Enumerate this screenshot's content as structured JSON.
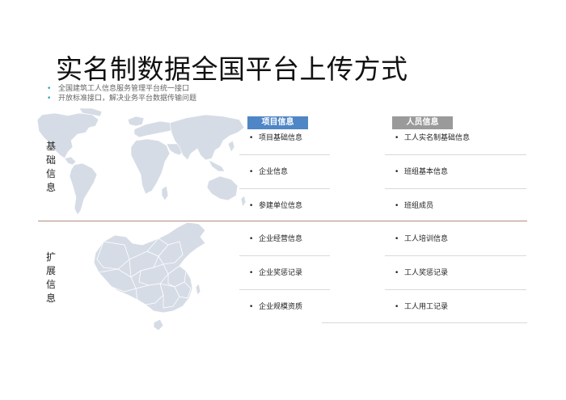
{
  "title": "实名制数据全国平台上传方式",
  "bullets": [
    "全国建筑工人信息服务管理平台统一接口",
    "开放标准接口，解决业务平台数据传输问题"
  ],
  "side_labels": {
    "basic": "基础信息",
    "extended": "扩展信息"
  },
  "columns": {
    "project": {
      "header": "项目信息",
      "items": [
        "项目基础信息",
        "企业信息",
        "参建单位信息",
        "企业经营信息",
        "企业奖惩记录",
        "企业规模资质"
      ]
    },
    "people": {
      "header": "人员信息",
      "items": [
        "工人实名制基础信息",
        "班组基本信息",
        "班组成员",
        "工人培训信息",
        "工人奖惩记录",
        "工人用工记录"
      ]
    }
  },
  "colors": {
    "project_header": "#4f86c6",
    "people_header": "#9a9a9a",
    "map_fill": "#d6dce6",
    "bullet_dot": "#2fa6a6",
    "divider": "#b28a7e"
  },
  "icons": {
    "bullet": "dot-icon",
    "world_map": "world-map",
    "china_map": "china-map"
  }
}
